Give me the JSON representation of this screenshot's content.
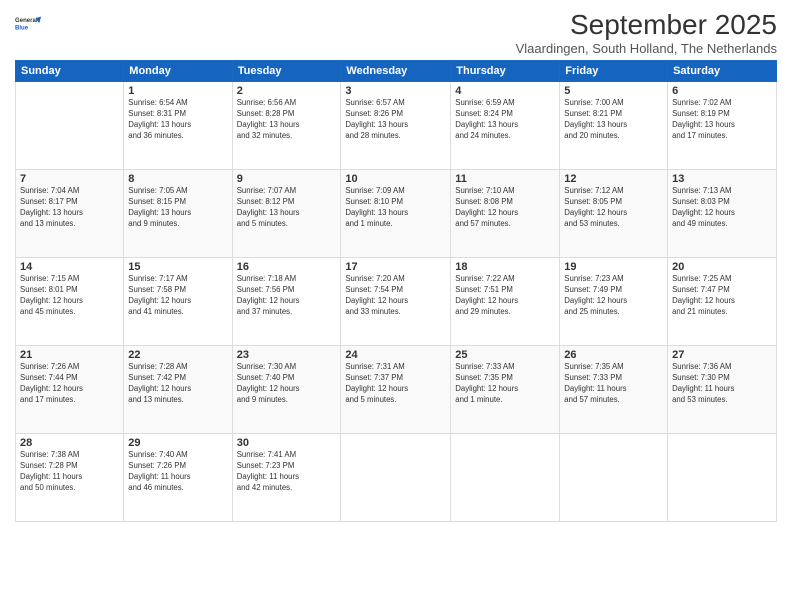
{
  "logo": {
    "line1": "General",
    "line2": "Blue"
  },
  "title": "September 2025",
  "subtitle": "Vlaardingen, South Holland, The Netherlands",
  "weekdays": [
    "Sunday",
    "Monday",
    "Tuesday",
    "Wednesday",
    "Thursday",
    "Friday",
    "Saturday"
  ],
  "weeks": [
    [
      {
        "day": "",
        "info": ""
      },
      {
        "day": "1",
        "info": "Sunrise: 6:54 AM\nSunset: 8:31 PM\nDaylight: 13 hours\nand 36 minutes."
      },
      {
        "day": "2",
        "info": "Sunrise: 6:56 AM\nSunset: 8:28 PM\nDaylight: 13 hours\nand 32 minutes."
      },
      {
        "day": "3",
        "info": "Sunrise: 6:57 AM\nSunset: 8:26 PM\nDaylight: 13 hours\nand 28 minutes."
      },
      {
        "day": "4",
        "info": "Sunrise: 6:59 AM\nSunset: 8:24 PM\nDaylight: 13 hours\nand 24 minutes."
      },
      {
        "day": "5",
        "info": "Sunrise: 7:00 AM\nSunset: 8:21 PM\nDaylight: 13 hours\nand 20 minutes."
      },
      {
        "day": "6",
        "info": "Sunrise: 7:02 AM\nSunset: 8:19 PM\nDaylight: 13 hours\nand 17 minutes."
      }
    ],
    [
      {
        "day": "7",
        "info": "Sunrise: 7:04 AM\nSunset: 8:17 PM\nDaylight: 13 hours\nand 13 minutes."
      },
      {
        "day": "8",
        "info": "Sunrise: 7:05 AM\nSunset: 8:15 PM\nDaylight: 13 hours\nand 9 minutes."
      },
      {
        "day": "9",
        "info": "Sunrise: 7:07 AM\nSunset: 8:12 PM\nDaylight: 13 hours\nand 5 minutes."
      },
      {
        "day": "10",
        "info": "Sunrise: 7:09 AM\nSunset: 8:10 PM\nDaylight: 13 hours\nand 1 minute."
      },
      {
        "day": "11",
        "info": "Sunrise: 7:10 AM\nSunset: 8:08 PM\nDaylight: 12 hours\nand 57 minutes."
      },
      {
        "day": "12",
        "info": "Sunrise: 7:12 AM\nSunset: 8:05 PM\nDaylight: 12 hours\nand 53 minutes."
      },
      {
        "day": "13",
        "info": "Sunrise: 7:13 AM\nSunset: 8:03 PM\nDaylight: 12 hours\nand 49 minutes."
      }
    ],
    [
      {
        "day": "14",
        "info": "Sunrise: 7:15 AM\nSunset: 8:01 PM\nDaylight: 12 hours\nand 45 minutes."
      },
      {
        "day": "15",
        "info": "Sunrise: 7:17 AM\nSunset: 7:58 PM\nDaylight: 12 hours\nand 41 minutes."
      },
      {
        "day": "16",
        "info": "Sunrise: 7:18 AM\nSunset: 7:56 PM\nDaylight: 12 hours\nand 37 minutes."
      },
      {
        "day": "17",
        "info": "Sunrise: 7:20 AM\nSunset: 7:54 PM\nDaylight: 12 hours\nand 33 minutes."
      },
      {
        "day": "18",
        "info": "Sunrise: 7:22 AM\nSunset: 7:51 PM\nDaylight: 12 hours\nand 29 minutes."
      },
      {
        "day": "19",
        "info": "Sunrise: 7:23 AM\nSunset: 7:49 PM\nDaylight: 12 hours\nand 25 minutes."
      },
      {
        "day": "20",
        "info": "Sunrise: 7:25 AM\nSunset: 7:47 PM\nDaylight: 12 hours\nand 21 minutes."
      }
    ],
    [
      {
        "day": "21",
        "info": "Sunrise: 7:26 AM\nSunset: 7:44 PM\nDaylight: 12 hours\nand 17 minutes."
      },
      {
        "day": "22",
        "info": "Sunrise: 7:28 AM\nSunset: 7:42 PM\nDaylight: 12 hours\nand 13 minutes."
      },
      {
        "day": "23",
        "info": "Sunrise: 7:30 AM\nSunset: 7:40 PM\nDaylight: 12 hours\nand 9 minutes."
      },
      {
        "day": "24",
        "info": "Sunrise: 7:31 AM\nSunset: 7:37 PM\nDaylight: 12 hours\nand 5 minutes."
      },
      {
        "day": "25",
        "info": "Sunrise: 7:33 AM\nSunset: 7:35 PM\nDaylight: 12 hours\nand 1 minute."
      },
      {
        "day": "26",
        "info": "Sunrise: 7:35 AM\nSunset: 7:33 PM\nDaylight: 11 hours\nand 57 minutes."
      },
      {
        "day": "27",
        "info": "Sunrise: 7:36 AM\nSunset: 7:30 PM\nDaylight: 11 hours\nand 53 minutes."
      }
    ],
    [
      {
        "day": "28",
        "info": "Sunrise: 7:38 AM\nSunset: 7:28 PM\nDaylight: 11 hours\nand 50 minutes."
      },
      {
        "day": "29",
        "info": "Sunrise: 7:40 AM\nSunset: 7:26 PM\nDaylight: 11 hours\nand 46 minutes."
      },
      {
        "day": "30",
        "info": "Sunrise: 7:41 AM\nSunset: 7:23 PM\nDaylight: 11 hours\nand 42 minutes."
      },
      {
        "day": "",
        "info": ""
      },
      {
        "day": "",
        "info": ""
      },
      {
        "day": "",
        "info": ""
      },
      {
        "day": "",
        "info": ""
      }
    ]
  ]
}
